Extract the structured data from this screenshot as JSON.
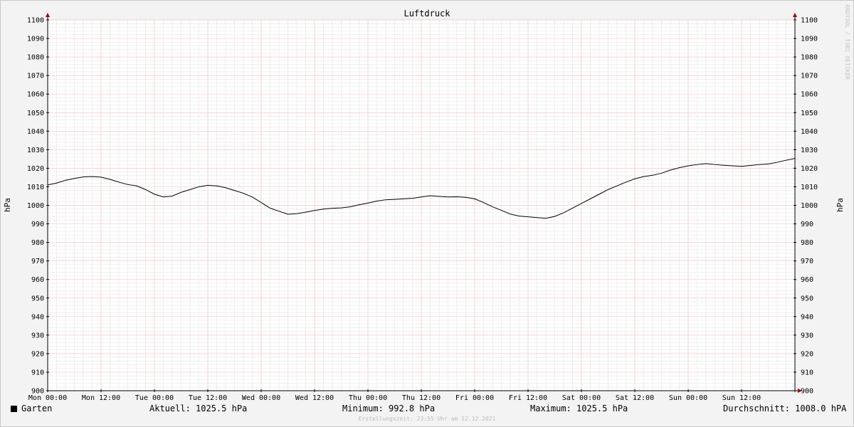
{
  "chart_data": {
    "type": "line",
    "title": "Luftdruck",
    "ylabel": "hPa",
    "ylabel_right": "hPa",
    "ylim": [
      900,
      1100
    ],
    "yticks": [
      900,
      910,
      920,
      930,
      940,
      950,
      960,
      970,
      980,
      990,
      1000,
      1010,
      1020,
      1030,
      1040,
      1050,
      1060,
      1070,
      1080,
      1090,
      1100
    ],
    "xticks": [
      "Mon 00:00",
      "Mon 12:00",
      "Tue 00:00",
      "Tue 12:00",
      "Wed 00:00",
      "Wed 12:00",
      "Thu 00:00",
      "Thu 12:00",
      "Fri 00:00",
      "Fri 12:00",
      "Sat 00:00",
      "Sat 12:00",
      "Sun 00:00",
      "Sun 12:00"
    ],
    "xlim_hours": [
      0,
      168
    ],
    "grid": true,
    "legend_placement": "bottom-left",
    "colors": {
      "line": "#000000",
      "major_grid": "#e89090",
      "minor_grid": "#cfcfcf",
      "plot_bg": "#ffffff",
      "arrow": "#a00000"
    },
    "series": [
      {
        "name": "Garten",
        "x_hours": [
          0,
          2,
          4,
          6,
          8,
          10,
          12,
          14,
          16,
          18,
          20,
          22,
          24,
          26,
          28,
          30,
          32,
          34,
          36,
          38,
          40,
          42,
          44,
          46,
          48,
          50,
          52,
          54,
          56,
          58,
          60,
          62,
          64,
          66,
          68,
          70,
          72,
          74,
          76,
          78,
          80,
          82,
          84,
          86,
          88,
          90,
          92,
          94,
          96,
          98,
          100,
          102,
          104,
          106,
          108,
          110,
          112,
          114,
          116,
          118,
          120,
          122,
          124,
          126,
          128,
          130,
          132,
          134,
          136,
          138,
          140,
          142,
          144,
          146,
          148,
          150,
          152,
          154,
          156,
          158,
          160,
          162,
          164,
          166,
          168
        ],
        "values": [
          1011.0,
          1012.0,
          1013.5,
          1014.5,
          1015.3,
          1015.5,
          1015.2,
          1014.0,
          1012.5,
          1011.2,
          1010.5,
          1008.5,
          1006.0,
          1004.5,
          1005.0,
          1007.0,
          1008.5,
          1010.0,
          1010.8,
          1010.5,
          1009.5,
          1008.0,
          1006.5,
          1004.5,
          1001.5,
          998.5,
          996.8,
          995.2,
          995.5,
          996.3,
          997.2,
          998.0,
          998.4,
          998.6,
          999.2,
          1000.3,
          1001.2,
          1002.3,
          1003.0,
          1003.2,
          1003.5,
          1003.8,
          1004.5,
          1005.2,
          1004.8,
          1004.5,
          1004.6,
          1004.3,
          1003.5,
          1001.5,
          999.2,
          997.3,
          995.3,
          994.2,
          993.8,
          993.4,
          993.0,
          994.0,
          996.0,
          998.5,
          1001.0,
          1003.5,
          1006.0,
          1008.5,
          1010.5,
          1012.5,
          1014.3,
          1015.5,
          1016.2,
          1017.3,
          1019.0,
          1020.3,
          1021.3,
          1022.0,
          1022.5,
          1022.0,
          1021.6,
          1021.3,
          1021.0,
          1021.5,
          1022.0,
          1022.3,
          1023.2,
          1024.3,
          1025.3
        ]
      }
    ]
  },
  "legend": {
    "series_name": "Garten"
  },
  "stats": {
    "current": "Aktuell: 1025.5 hPa",
    "minimum": "Minimum: 992.8 hPa",
    "maximum": "Maximum: 1025.5 hPa",
    "average": "Durchschnitt: 1008.0 hPA"
  },
  "footer": {
    "created": "Erstellungszeit: 23:55 Uhr am 12.12.2021"
  },
  "watermark": "RRDTOOL / TOBI OETIKER"
}
